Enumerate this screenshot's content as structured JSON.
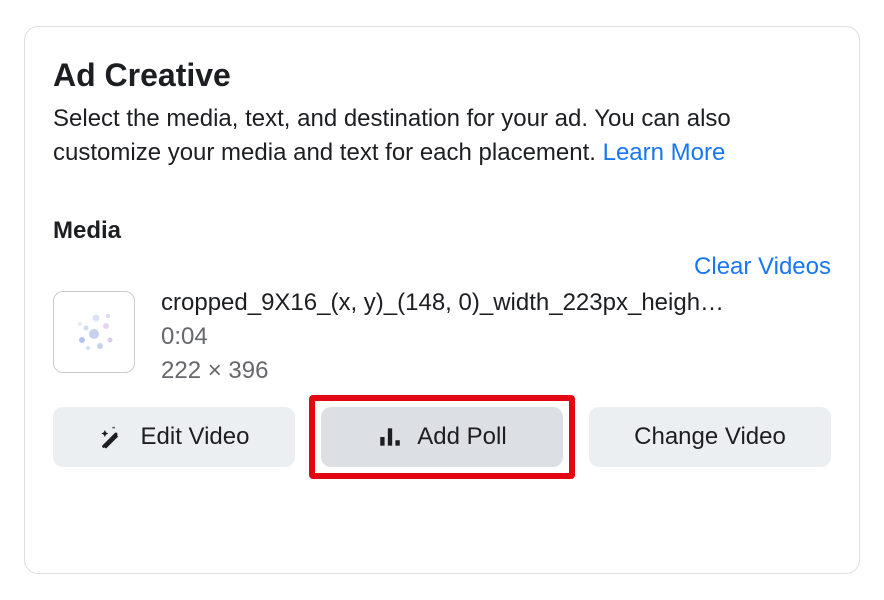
{
  "header": {
    "title": "Ad Creative",
    "subtitle_prefix": "Select the media, text, and destination for your ad. You can also customize your media and text for each placement. ",
    "learn_more": "Learn More"
  },
  "media": {
    "section_label": "Media",
    "clear_label": "Clear Videos",
    "item": {
      "filename": "cropped_9X16_(x, y)_(148, 0)_width_223px_heigh…",
      "duration": "0:04",
      "dimensions": "222 × 396"
    }
  },
  "actions": {
    "edit_video": "Edit Video",
    "add_poll": "Add Poll",
    "change_video": "Change Video"
  }
}
